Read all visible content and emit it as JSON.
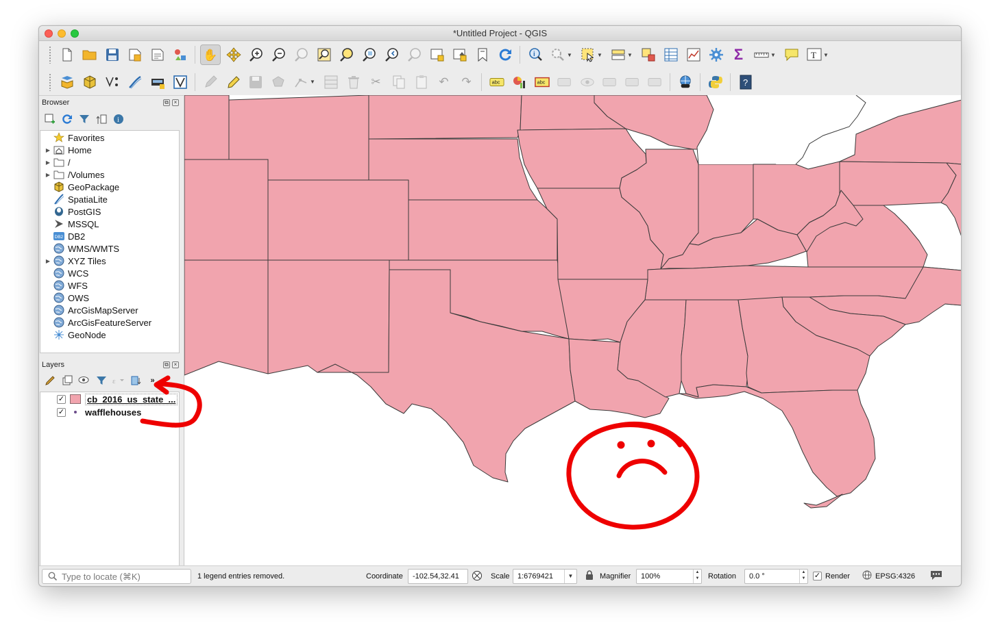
{
  "window": {
    "title": "*Untitled Project - QGIS"
  },
  "toolbar1": {
    "icons": [
      "new-project-icon",
      "open-project-icon",
      "save-project-icon",
      "save-as-icon",
      "print-layout-icon",
      "style-manager-icon",
      "pan-icon",
      "pan-to-selection-icon",
      "zoom-in-icon",
      "zoom-out-icon",
      "zoom-native-icon",
      "zoom-full-icon",
      "zoom-to-selection-icon",
      "zoom-to-layer-icon",
      "zoom-last-icon",
      "zoom-next-icon",
      "new-map-view-icon",
      "new-3d-view-icon",
      "bookmark-new-icon",
      "bookmarks-icon",
      "refresh-icon",
      "identify-icon",
      "actions-icon",
      "select-features-icon",
      "select-by-value-icon",
      "deselect-icon",
      "attribute-table-icon",
      "statistics-icon",
      "toolbox-icon",
      "field-calculator-icon",
      "measure-icon",
      "map-tips-icon",
      "text-annotation-icon"
    ]
  },
  "toolbar2": {
    "icons": [
      "data-source-manager-icon",
      "new-geopackage-layer-icon",
      "new-shapefile-layer-icon",
      "new-spatialite-icon",
      "new-temporary-layer-icon",
      "new-virtual-layer-icon",
      "digitize-icon",
      "toggle-editing-icon",
      "save-edits-icon",
      "add-feature-icon",
      "vertex-tool-icon",
      "modify-attributes-icon",
      "delete-selected-icon",
      "cut-features-icon",
      "copy-features-icon",
      "paste-features-icon",
      "undo-icon",
      "redo-icon",
      "label-tool-icon",
      "diagram-tool-icon",
      "highlight-labels-icon",
      "pin-labels-icon",
      "show-hide-labels-icon",
      "move-label-icon",
      "rotate-label-icon",
      "change-label-icon",
      "plugin-manager-icon",
      "python-console-icon",
      "help-icon"
    ]
  },
  "browser": {
    "title": "Browser",
    "items": [
      {
        "label": "Favorites",
        "icon": "star-icon",
        "expandable": false
      },
      {
        "label": "Home",
        "icon": "home-folder-icon",
        "expandable": true
      },
      {
        "label": "/",
        "icon": "folder-icon",
        "expandable": true
      },
      {
        "label": "/Volumes",
        "icon": "folder-icon",
        "expandable": true
      },
      {
        "label": "GeoPackage",
        "icon": "geopackage-icon",
        "expandable": false
      },
      {
        "label": "SpatiaLite",
        "icon": "spatialite-icon",
        "expandable": false
      },
      {
        "label": "PostGIS",
        "icon": "postgis-icon",
        "expandable": false
      },
      {
        "label": "MSSQL",
        "icon": "mssql-icon",
        "expandable": false
      },
      {
        "label": "DB2",
        "icon": "db2-icon",
        "expandable": false
      },
      {
        "label": "WMS/WMTS",
        "icon": "globe-icon",
        "expandable": false
      },
      {
        "label": "XYZ Tiles",
        "icon": "globe-icon",
        "expandable": true
      },
      {
        "label": "WCS",
        "icon": "globe-icon",
        "expandable": false
      },
      {
        "label": "WFS",
        "icon": "globe-icon",
        "expandable": false
      },
      {
        "label": "OWS",
        "icon": "globe-icon",
        "expandable": false
      },
      {
        "label": "ArcGisMapServer",
        "icon": "globe-icon",
        "expandable": false
      },
      {
        "label": "ArcGisFeatureServer",
        "icon": "globe-icon",
        "expandable": false
      },
      {
        "label": "GeoNode",
        "icon": "geonode-icon",
        "expandable": false
      }
    ]
  },
  "layers": {
    "title": "Layers",
    "items": [
      {
        "name": "cb_2016_us_state_...",
        "checked": true,
        "symbol": "fill",
        "color": "#f1a4ae"
      },
      {
        "name": "wafflehouses",
        "checked": true,
        "symbol": "point",
        "color": "#6b4c8a"
      }
    ]
  },
  "map": {
    "fill_color": "#f1a4ae",
    "stroke_color": "#3a3a3a"
  },
  "annotations": {
    "color": "#ee0000",
    "shapes": [
      "arrow-icon",
      "sad-face-icon"
    ]
  },
  "status": {
    "locator_placeholder": "Type to locate (⌘K)",
    "message": "1 legend entries removed.",
    "coordinate_label": "Coordinate",
    "coordinate_value": "-102.54,32.41",
    "scale_label": "Scale",
    "scale_value": "1:6769421",
    "magnifier_label": "Magnifier",
    "magnifier_value": "100%",
    "rotation_label": "Rotation",
    "rotation_value": "0.0 °",
    "render_label": "Render",
    "render_checked": true,
    "crs": "EPSG:4326"
  }
}
